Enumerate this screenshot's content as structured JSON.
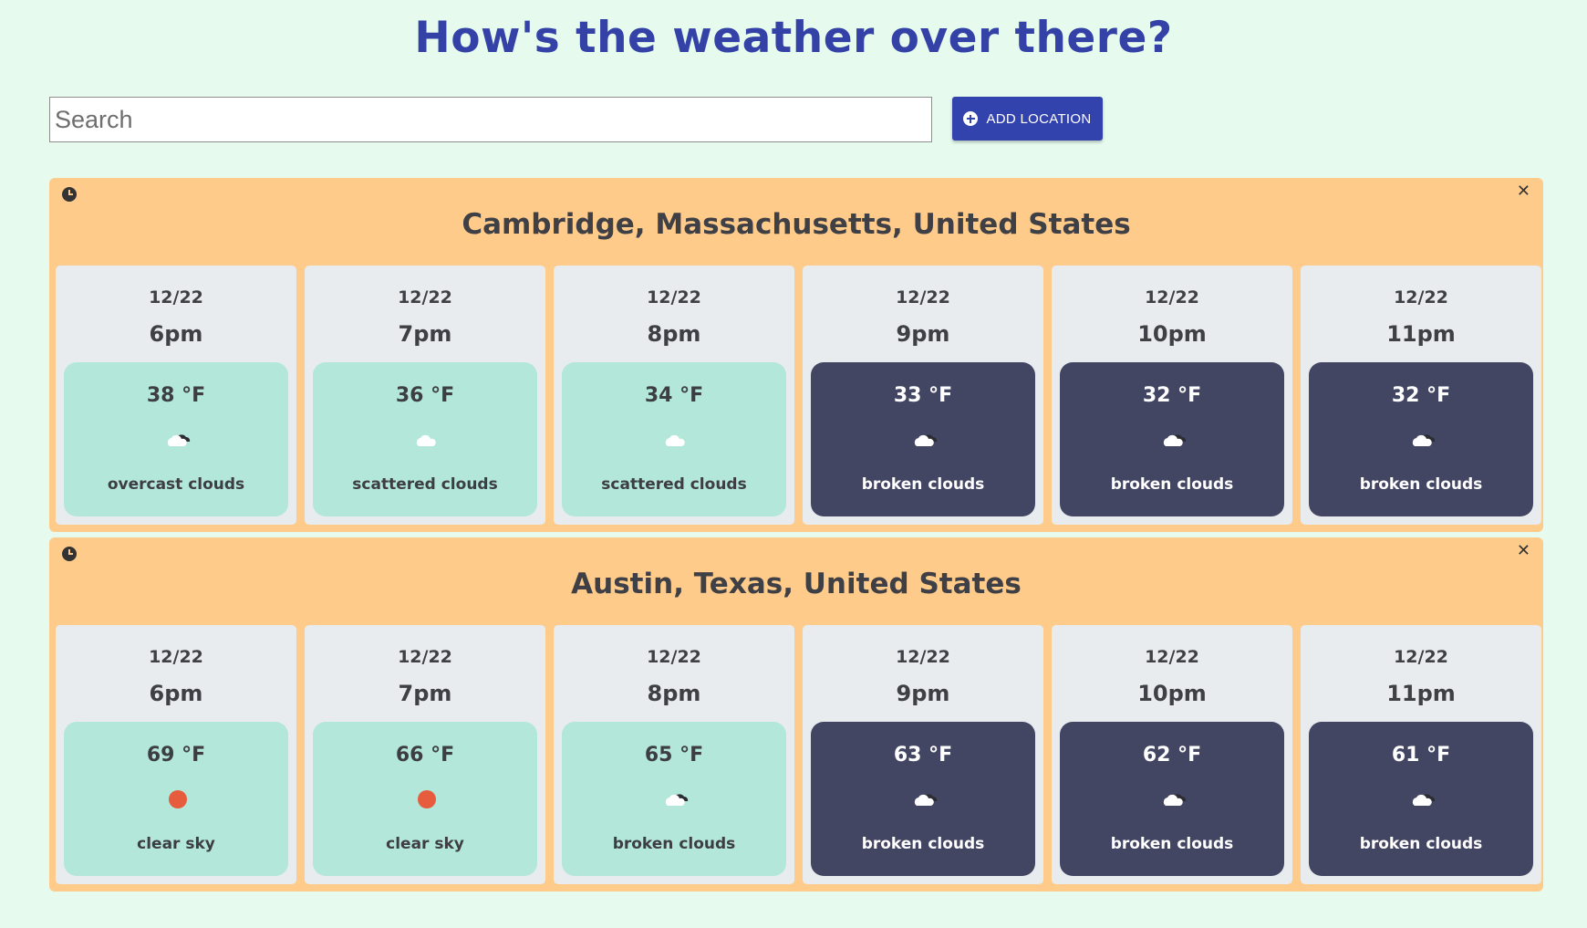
{
  "app": {
    "title": "How's the weather over there?"
  },
  "search": {
    "placeholder": "Search",
    "value": ""
  },
  "toolbar": {
    "add_label": "ADD LOCATION",
    "add_icon": "plus-circle-icon"
  },
  "colors": {
    "page_bg": "#e6fbee",
    "title": "#3442a8",
    "accent": "#3343ae",
    "location_card": "#ffcb8a",
    "hour_card": "#e8ecef",
    "day_box": "#b3e7da",
    "night_box": "#434663",
    "sun": "#e65c3c"
  },
  "locations": [
    {
      "name": "Cambridge, Massachusetts, United States",
      "hours": [
        {
          "date": "12/22",
          "time": "6pm",
          "temp": "38 °F",
          "desc": "overcast clouds",
          "icon": "overcast-clouds-icon",
          "period": "day"
        },
        {
          "date": "12/22",
          "time": "7pm",
          "temp": "36 °F",
          "desc": "scattered clouds",
          "icon": "scattered-clouds-icon",
          "period": "day"
        },
        {
          "date": "12/22",
          "time": "8pm",
          "temp": "34 °F",
          "desc": "scattered clouds",
          "icon": "scattered-clouds-icon",
          "period": "day"
        },
        {
          "date": "12/22",
          "time": "9pm",
          "temp": "33 °F",
          "desc": "broken clouds",
          "icon": "broken-clouds-icon",
          "period": "night"
        },
        {
          "date": "12/22",
          "time": "10pm",
          "temp": "32 °F",
          "desc": "broken clouds",
          "icon": "broken-clouds-icon",
          "period": "night"
        },
        {
          "date": "12/22",
          "time": "11pm",
          "temp": "32 °F",
          "desc": "broken clouds",
          "icon": "broken-clouds-icon",
          "period": "night"
        }
      ]
    },
    {
      "name": "Austin, Texas, United States",
      "hours": [
        {
          "date": "12/22",
          "time": "6pm",
          "temp": "69 °F",
          "desc": "clear sky",
          "icon": "sun-icon",
          "period": "day"
        },
        {
          "date": "12/22",
          "time": "7pm",
          "temp": "66 °F",
          "desc": "clear sky",
          "icon": "sun-icon",
          "period": "day"
        },
        {
          "date": "12/22",
          "time": "8pm",
          "temp": "65 °F",
          "desc": "broken clouds",
          "icon": "broken-clouds-icon",
          "period": "day"
        },
        {
          "date": "12/22",
          "time": "9pm",
          "temp": "63 °F",
          "desc": "broken clouds",
          "icon": "broken-clouds-icon",
          "period": "night"
        },
        {
          "date": "12/22",
          "time": "10pm",
          "temp": "62 °F",
          "desc": "broken clouds",
          "icon": "broken-clouds-icon",
          "period": "night"
        },
        {
          "date": "12/22",
          "time": "11pm",
          "temp": "61 °F",
          "desc": "broken clouds",
          "icon": "broken-clouds-icon",
          "period": "night"
        }
      ]
    }
  ]
}
